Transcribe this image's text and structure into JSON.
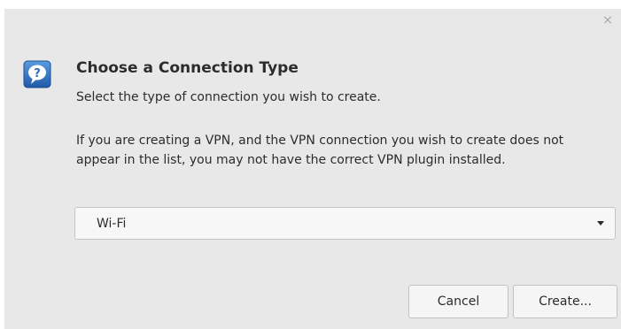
{
  "dialog": {
    "close_glyph": "×",
    "icon": "question-icon",
    "title": "Choose a Connection Type",
    "subtitle": "Select the type of connection you wish to create.",
    "info": "If you are creating a VPN, and the VPN connection you wish to create does not appear in the list, you may not have the correct VPN plugin installed.",
    "connection_type": {
      "selected": "Wi-Fi"
    },
    "buttons": {
      "cancel_label": "Cancel",
      "create_label": "Create..."
    }
  },
  "colors": {
    "dialog_bg": "#e8e8e8",
    "icon_blue": "#2e6dbd",
    "text": "#2c2c2c"
  }
}
